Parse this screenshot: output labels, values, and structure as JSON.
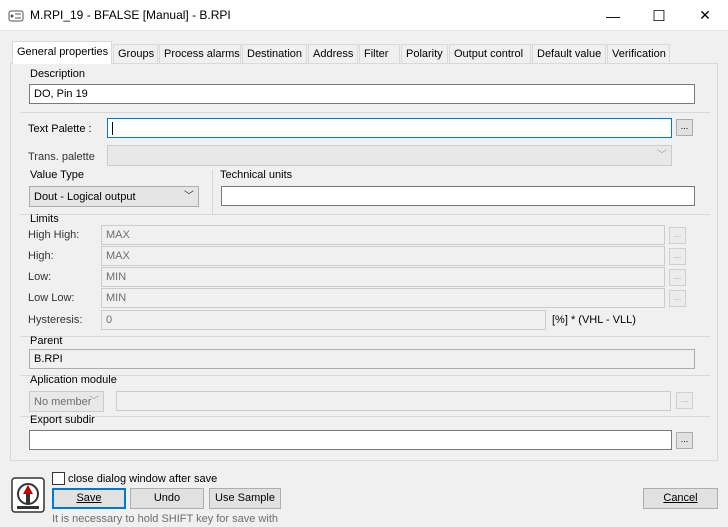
{
  "window": {
    "title": "M.RPI_19 - BFALSE [Manual] - B.RPI",
    "minimize_glyph": "—",
    "maximize_glyph": "☐",
    "close_glyph": "✕"
  },
  "tabs": [
    {
      "label": "General properties",
      "active": true
    },
    {
      "label": "Groups"
    },
    {
      "label": "Process alarms"
    },
    {
      "label": "Destination"
    },
    {
      "label": "Address"
    },
    {
      "label": "Filter"
    },
    {
      "label": "Polarity"
    },
    {
      "label": "Output control"
    },
    {
      "label": "Default value"
    },
    {
      "label": "Verification"
    }
  ],
  "general": {
    "description_label": "Description",
    "description_value": "DO, Pin 19",
    "text_palette_label": "Text Palette :",
    "text_palette_value": "",
    "trans_palette_label": "Trans. palette",
    "value_type_label": "Value Type",
    "value_type_selected": "Dout - Logical output",
    "technical_units_label": "Technical units",
    "technical_units_value": ""
  },
  "limits": {
    "label": "Limits",
    "high_high_label": "High High:",
    "high_high_value": "MAX",
    "high_label": "High:",
    "high_value": "MAX",
    "low_label": "Low:",
    "low_value": "MIN",
    "low_low_label": "Low Low:",
    "low_low_value": "MIN",
    "hysteresis_label": "Hysteresis:",
    "hysteresis_value": "0",
    "hysteresis_unit": "[%] * (VHL - VLL)"
  },
  "parent": {
    "label": "Parent",
    "value": "B.RPI"
  },
  "application_module": {
    "label": "Aplication module",
    "selected": "No member",
    "value": ""
  },
  "export_subdir": {
    "label": "Export subdir",
    "value": ""
  },
  "footer": {
    "close_after_save_label": "close dialog window after save",
    "close_after_save_checked": false,
    "save_label": "Save",
    "undo_label": "Undo",
    "use_sample_label": "Use Sample",
    "cancel_label": "Cancel",
    "hint": "It is necessary to hold SHIFT key for save with"
  },
  "dots": "...",
  "icons": {
    "app": "tag-icon",
    "logo": "device-logo-icon"
  }
}
